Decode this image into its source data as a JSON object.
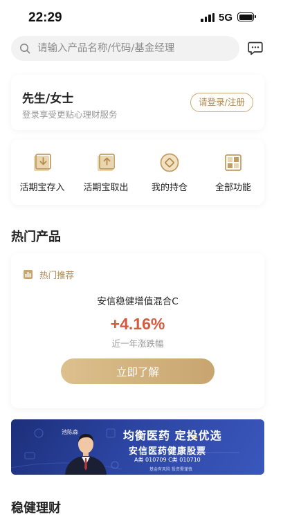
{
  "status_bar": {
    "time": "22:29",
    "network": "5G"
  },
  "search": {
    "placeholder": "请输入产品名称/代码/基金经理"
  },
  "user_card": {
    "title": "先生/女士",
    "subtitle": "登录享受更贴心理财服务",
    "login_label": "请登录/注册"
  },
  "quick_menu": [
    {
      "label": "活期宝存入",
      "icon": "deposit-icon"
    },
    {
      "label": "活期宝取出",
      "icon": "withdraw-icon"
    },
    {
      "label": "我的持仓",
      "icon": "holdings-icon"
    },
    {
      "label": "全部功能",
      "icon": "all-functions-icon"
    }
  ],
  "hot_section": {
    "title": "热门产品",
    "badge": "热门推荐",
    "product_name": "安信稳健增值混合C",
    "change": "+4.16%",
    "change_label": "近一年涨跌幅",
    "button_label": "立即了解"
  },
  "banner": {
    "person_name": "池陈森",
    "headline": "均衡医药 定投优选",
    "fund_name": "安信医药健康股票",
    "codes": "A类 010709  C类 010710",
    "disclaimer": "基金有风险  投资需谨慎"
  },
  "steady_section": {
    "title": "稳健理财"
  },
  "colors": {
    "gold": "#c8a56f",
    "red": "#d55b3e",
    "banner_blue": "#2c45a2"
  }
}
